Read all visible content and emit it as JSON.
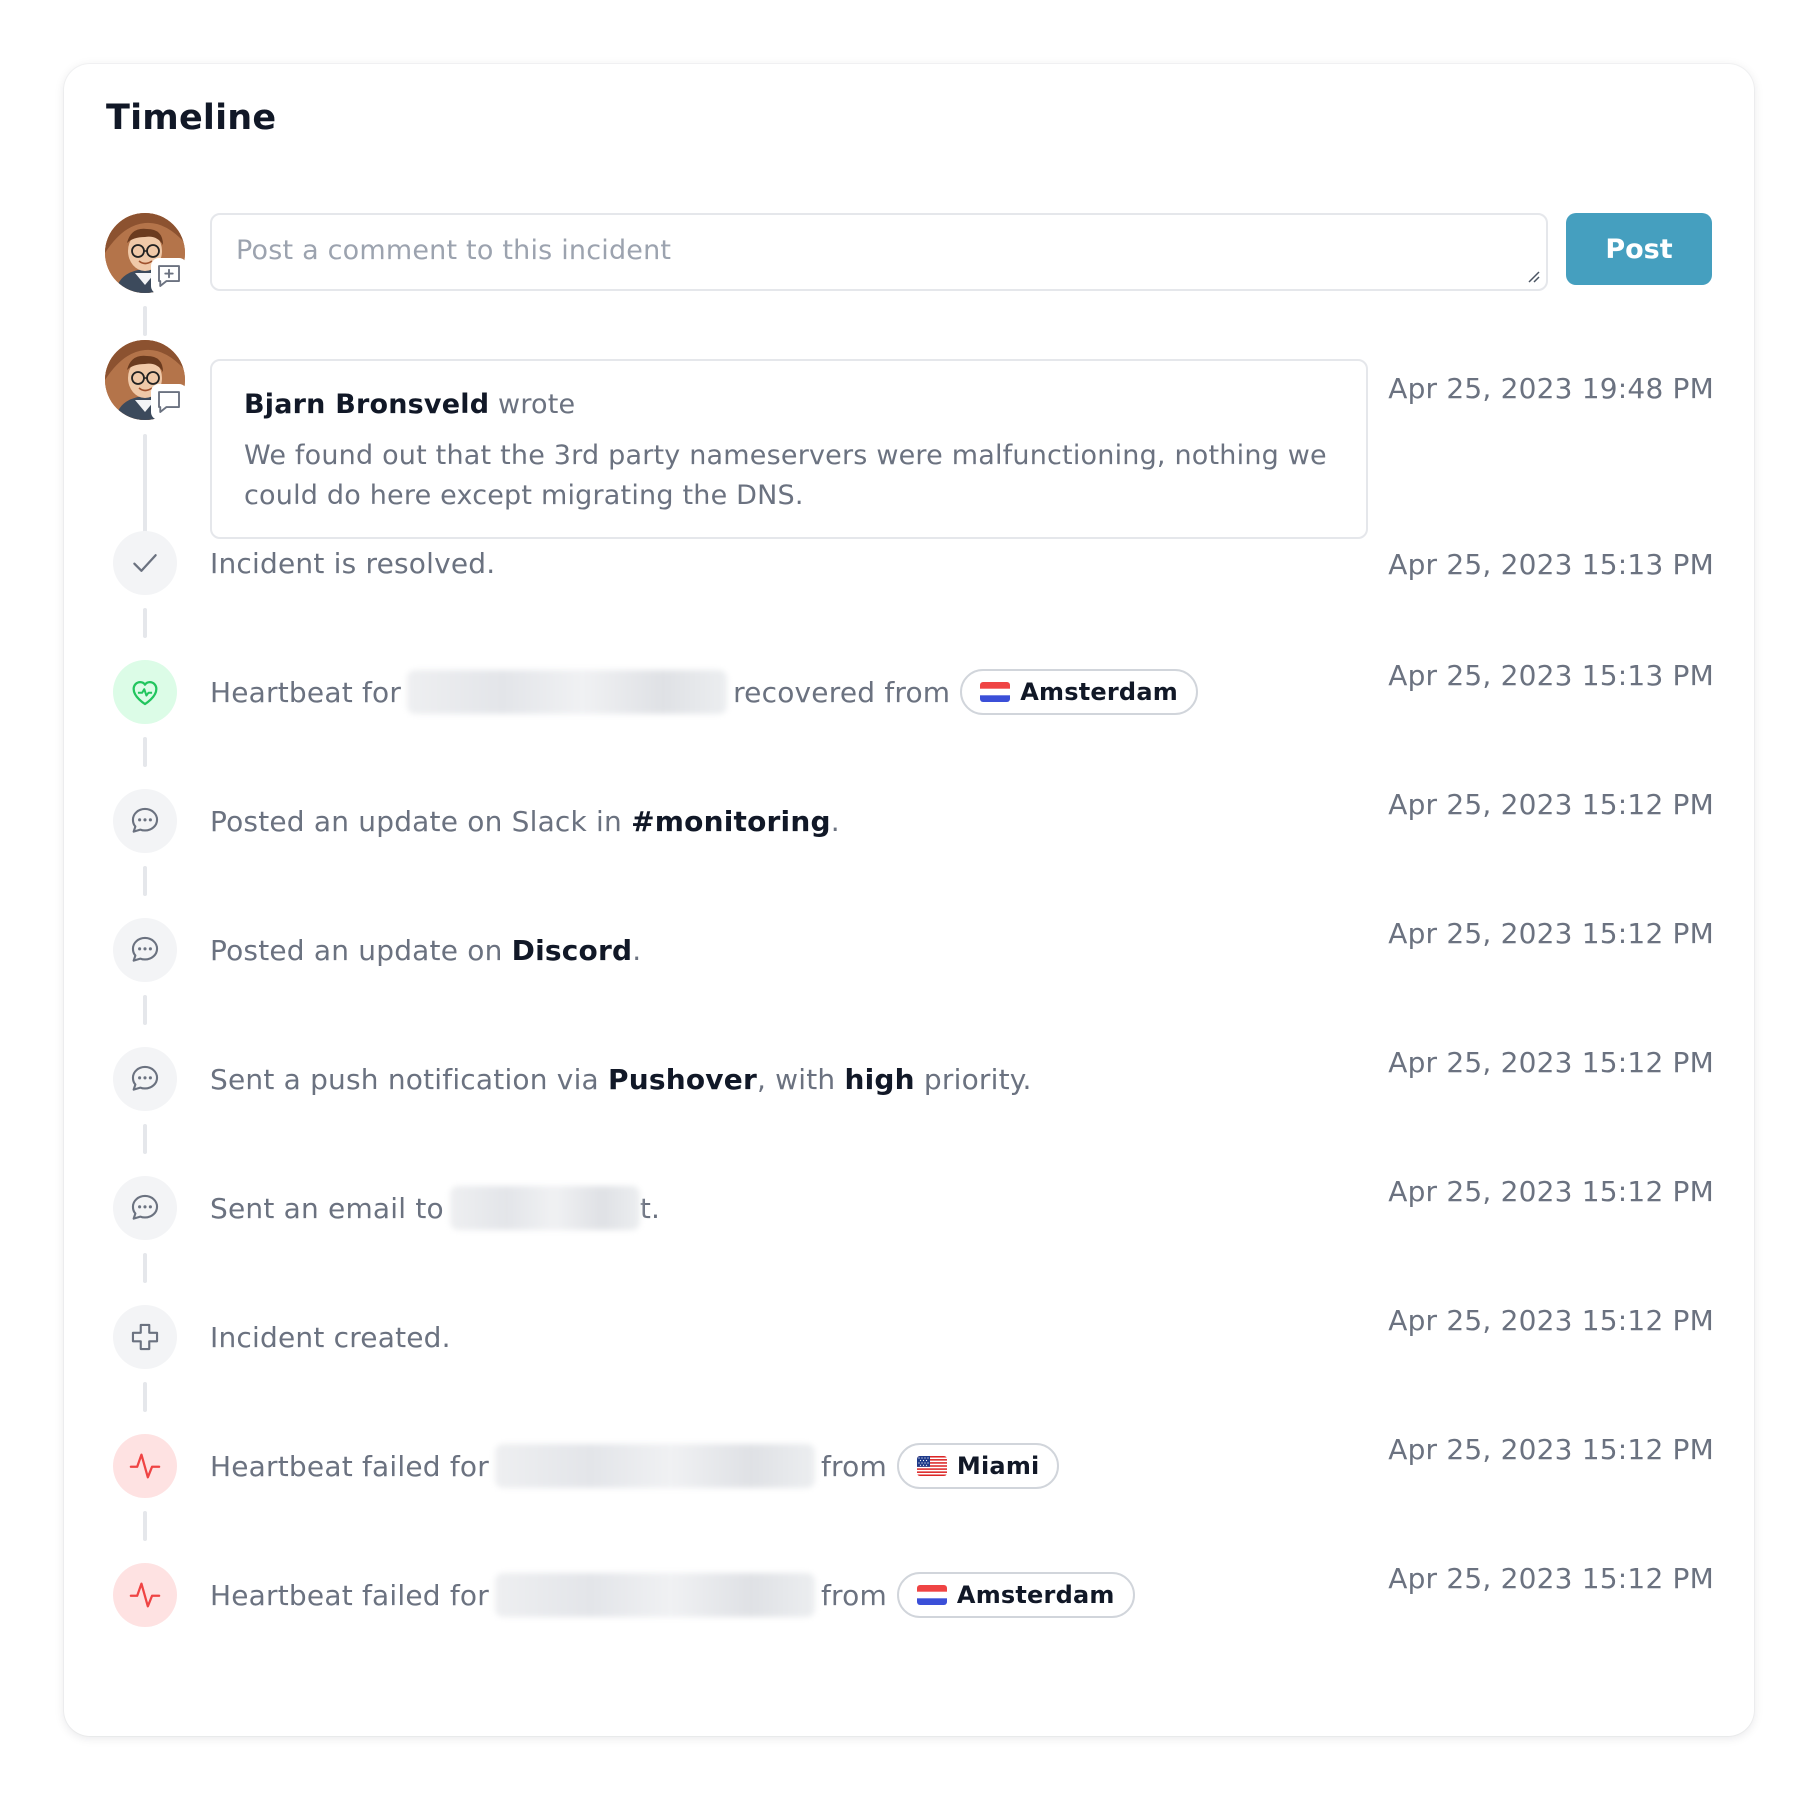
{
  "title": "Timeline",
  "composer": {
    "placeholder": "Post a comment to this incident",
    "post_label": "Post"
  },
  "comment": {
    "author": "Bjarn Bronsveld",
    "verb": "wrote",
    "body": "We found out that the 3rd party nameservers were malfunctioning, nothing we could do here except migrating the DNS.",
    "timestamp": "Apr 25, 2023 19:48 PM"
  },
  "events": [
    {
      "text": "Incident is resolved.",
      "timestamp": "Apr 25, 2023 15:13 PM",
      "icon": "check-icon"
    },
    {
      "prefix": "Heartbeat for",
      "middle": "recovered from",
      "location": "Amsterdam",
      "flag": "nl",
      "timestamp": "Apr 25, 2023 15:13 PM",
      "icon": "heart-icon"
    },
    {
      "prefix": "Posted an update on Slack in",
      "strong": "#monitoring",
      "suffix": ".",
      "timestamp": "Apr 25, 2023 15:12 PM",
      "icon": "chat-icon"
    },
    {
      "prefix": "Posted an update on",
      "strong": "Discord",
      "suffix": ".",
      "timestamp": "Apr 25, 2023 15:12 PM",
      "icon": "chat-icon"
    },
    {
      "prefix": "Sent a push notification via",
      "strong": "Pushover",
      "middle": ", with",
      "strong2": "high",
      "suffix": "priority.",
      "timestamp": "Apr 25, 2023 15:12 PM",
      "icon": "chat-icon"
    },
    {
      "prefix": "Sent an email to",
      "suffix": "t.",
      "timestamp": "Apr 25, 2023 15:12 PM",
      "icon": "chat-icon"
    },
    {
      "text": "Incident created.",
      "timestamp": "Apr 25, 2023 15:12 PM",
      "icon": "plus-icon"
    },
    {
      "prefix": "Heartbeat failed for",
      "middle": "from",
      "location": "Miami",
      "flag": "us",
      "timestamp": "Apr 25, 2023 15:12 PM",
      "icon": "pulse-icon"
    },
    {
      "prefix": "Heartbeat failed for",
      "middle": "from",
      "location": "Amsterdam",
      "flag": "nl",
      "timestamp": "Apr 25, 2023 15:12 PM",
      "icon": "pulse-icon"
    }
  ],
  "colors": {
    "accent": "#459fbf",
    "success": "#22c55e",
    "danger": "#ef4444"
  }
}
